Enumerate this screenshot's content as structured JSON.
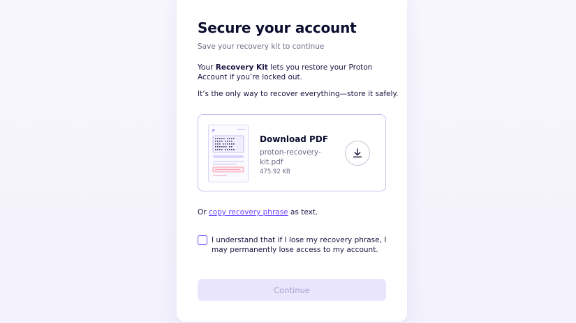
{
  "header": {
    "title": "Secure your account",
    "subtitle": "Save your recovery kit to continue"
  },
  "intro": {
    "prefix": "Your ",
    "bold": "Recovery Kit",
    "suffix": " lets you restore your Proton Account if you’re locked out."
  },
  "note": "It’s the only way to recover everything—store it safely.",
  "download": {
    "title": "Download PDF",
    "filename": "proton-recovery-kit.pdf",
    "size": "475.92 KB",
    "icon": "download-icon"
  },
  "alternative": {
    "prefix": "Or ",
    "link": "copy recovery phrase",
    "suffix": " as text."
  },
  "acknowledgement": {
    "label": "I understand that if I lose my recovery phrase, I may permanently lose access to my account.",
    "checked": false
  },
  "continue_button": {
    "label": "Continue",
    "disabled": true
  },
  "colors": {
    "accent": "#6d4aff",
    "disabled_button_bg": "#e9e5fd",
    "disabled_button_text": "#a9a2cf"
  }
}
